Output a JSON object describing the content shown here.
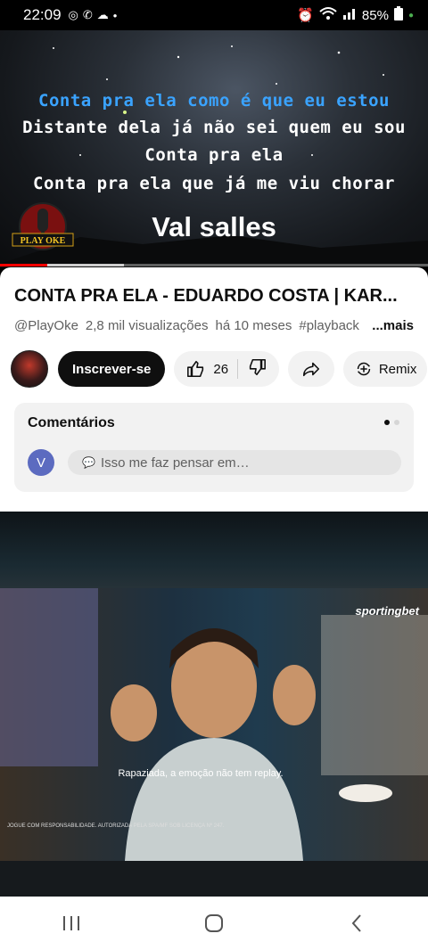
{
  "status_bar": {
    "time": "22:09",
    "battery": "85%"
  },
  "player": {
    "lyrics": [
      "Conta pra ela como é que eu estou",
      "Distante dela já não sei quem eu sou",
      "Conta pra ela",
      "Conta pra ela que já me viu chorar"
    ],
    "singer": "Val salles",
    "logo_text": "PLAY OKE",
    "progress": 0.11
  },
  "video": {
    "title": "CONTA PRA ELA - EDUARDO COSTA | KAR...",
    "channel": "@PlayOke",
    "views": "2,8 mil visualizações",
    "age": "há 10 meses",
    "tag": "#playback",
    "more": "...mais"
  },
  "actions": {
    "subscribe": "Inscrever-se",
    "likes": "26",
    "remix": "Remix"
  },
  "comments": {
    "header": "Comentários",
    "avatar_initial": "V",
    "placeholder": "Isso me faz pensar em…"
  },
  "ad": {
    "brand": "sportingbet",
    "caption": "Rapaziada, a emoção não tem replay.",
    "disclaimer": "JOGUE COM RESPONSABILIDADE. AUTORIZADA PELA SPA/MF SOB LICENÇA Nº 247."
  },
  "colors": {
    "accent_red": "#ff0000",
    "lyric_highlight": "#3aa3ff"
  }
}
